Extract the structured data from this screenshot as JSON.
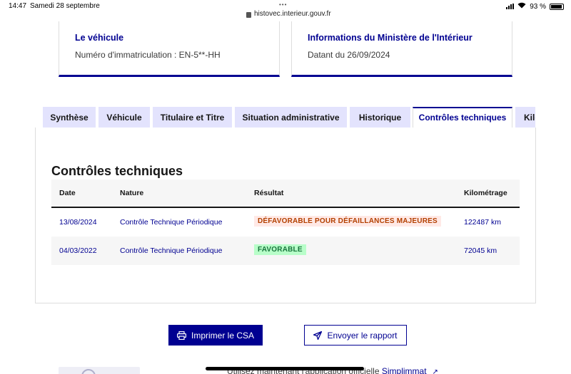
{
  "status_bar": {
    "time": "14:47",
    "date": "Samedi 28 septembre",
    "url": "histovec.interieur.gouv.fr",
    "battery": "93 %"
  },
  "cards": [
    {
      "title": "Le véhicule",
      "text": "Numéro d'immatriculation : EN-5**-HH"
    },
    {
      "title": "Informations du Ministère de l'Intérieur",
      "text": "Datant du 26/09/2024"
    }
  ],
  "tabs": [
    {
      "label": "Synthèse"
    },
    {
      "label": "Véhicule"
    },
    {
      "label": "Titulaire et Titre"
    },
    {
      "label": "Situation administrative"
    },
    {
      "label": "Historique"
    },
    {
      "label": "Contrôles techniques"
    },
    {
      "label": "Kilo"
    }
  ],
  "active_tab": "Contrôles techniques",
  "section_title": "Contrôles techniques",
  "table": {
    "headers": {
      "date": "Date",
      "nature": "Nature",
      "resultat": "Résultat",
      "kilometrage": "Kilométrage"
    },
    "rows": [
      {
        "date": "13/08/2024",
        "nature": "Contrôle Technique Périodique",
        "resultat": "DÉFAVORABLE POUR DÉFAILLANCES MAJEURES",
        "status": "unfavorable",
        "kilometrage": "122487 km"
      },
      {
        "date": "04/03/2022",
        "nature": "Contrôle Technique Périodique",
        "resultat": "FAVORABLE",
        "status": "favorable",
        "kilometrage": "72045 km"
      }
    ]
  },
  "buttons": {
    "print": {
      "label": "Imprimer le CSA",
      "icon": "printer-icon"
    },
    "send": {
      "label": "Envoyer le rapport",
      "icon": "send-icon"
    }
  },
  "bottom": {
    "text": "Utilisez maintenant l'application officielle ",
    "link": "Simplimmat",
    "icon": "external-link-icon"
  },
  "colors": {
    "primary": "#000091",
    "tab_bg": "#e3e3fd",
    "unfavorable_bg": "#ffe9e6",
    "unfavorable_text": "#b34000",
    "favorable_bg": "#b8fec9",
    "favorable_text": "#18753c"
  }
}
